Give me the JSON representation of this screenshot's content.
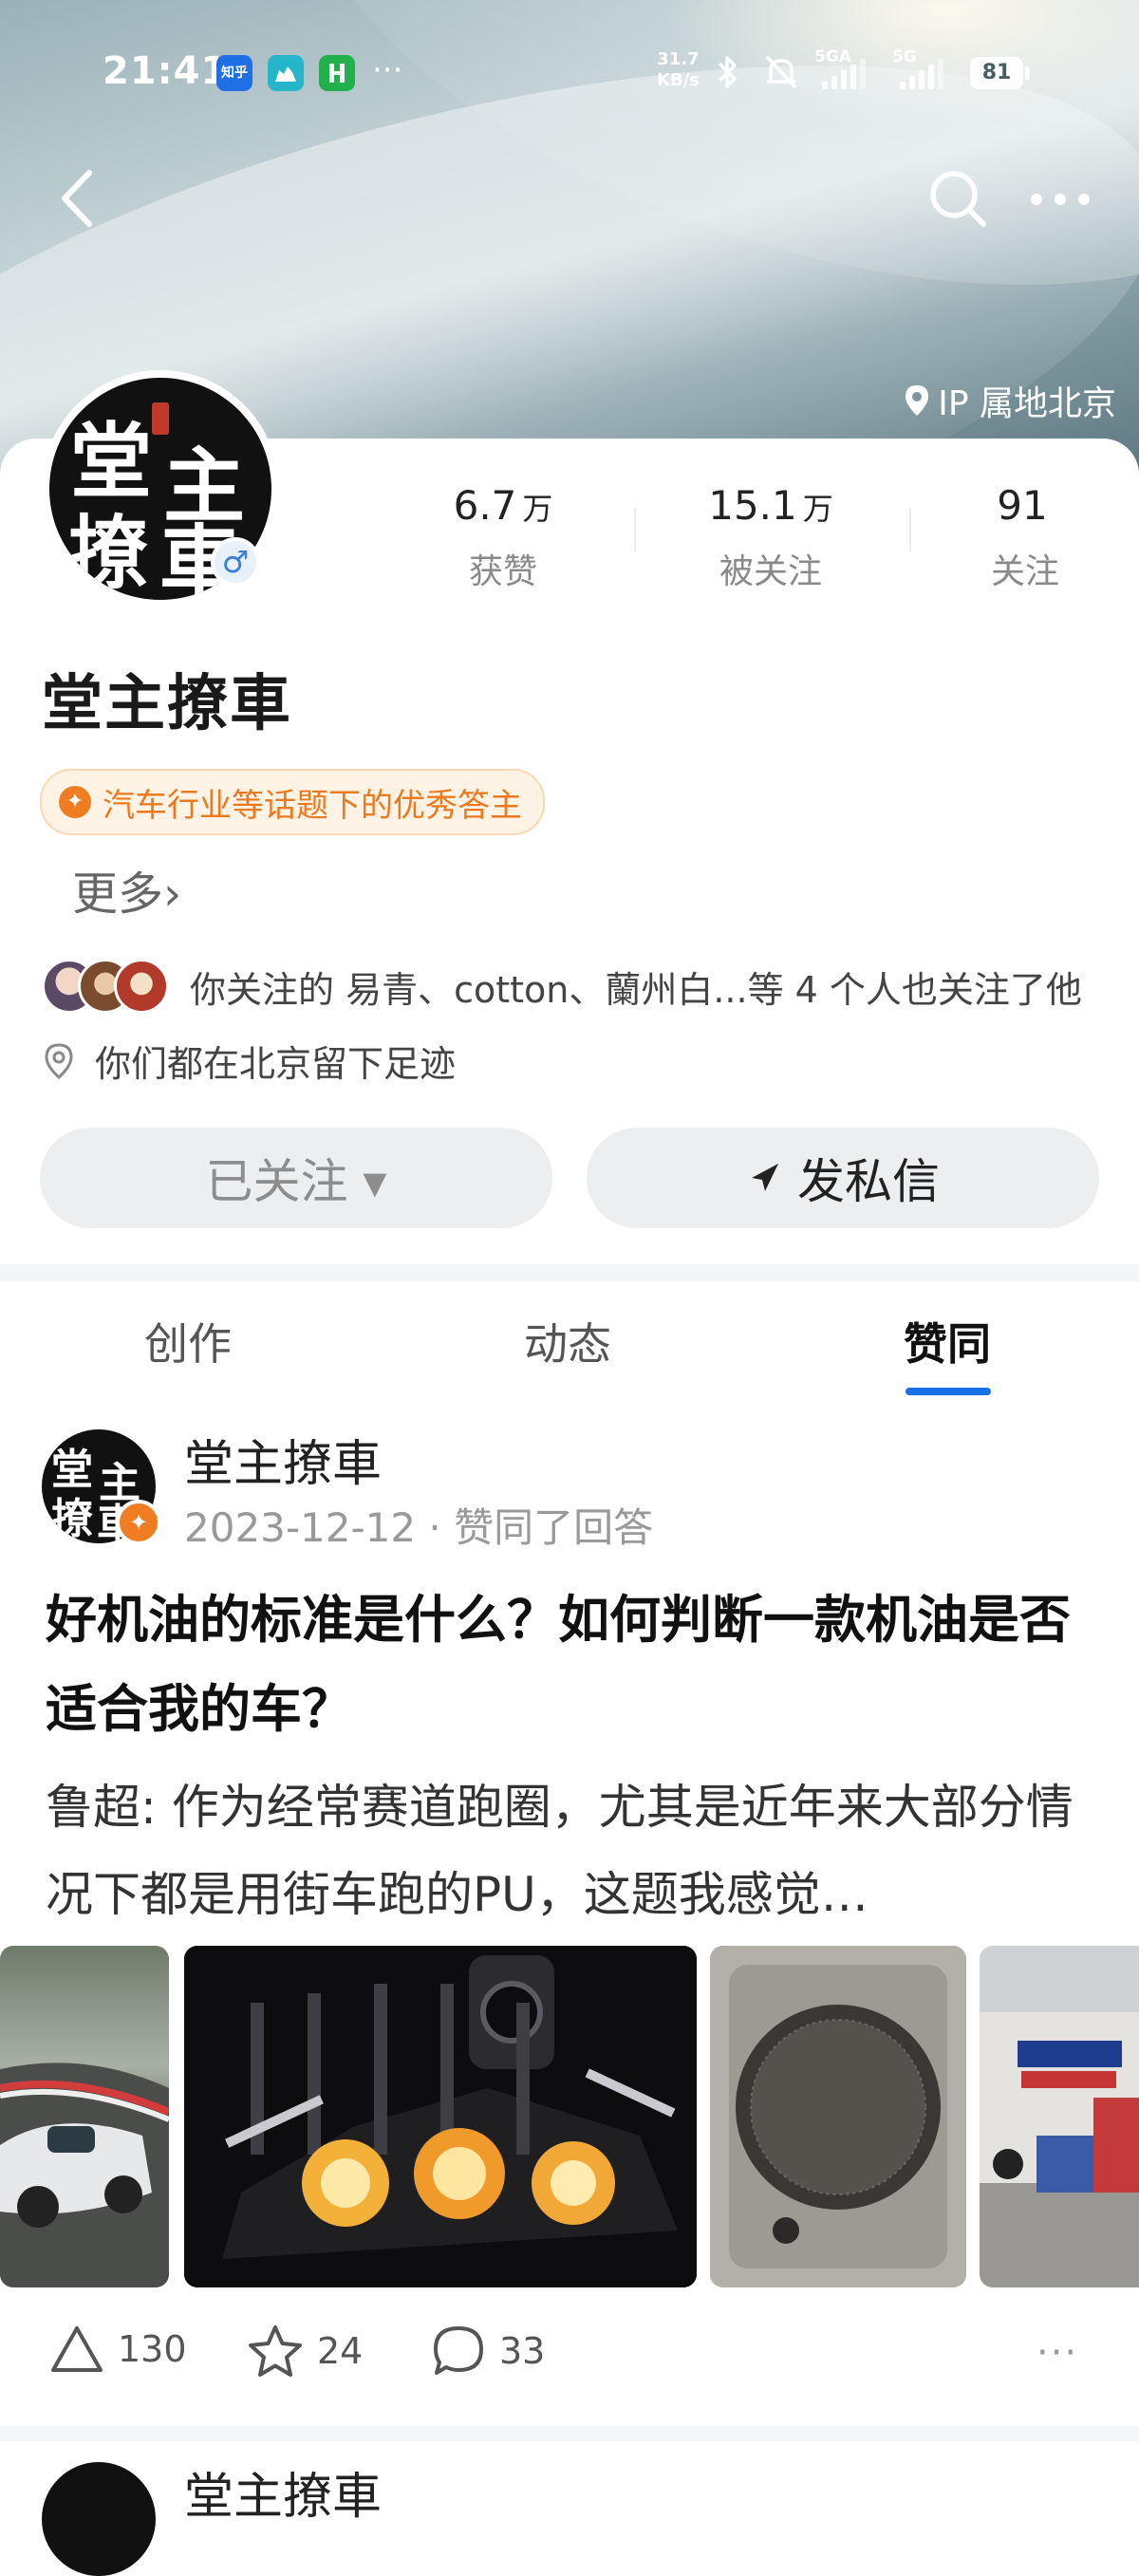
{
  "status_bar": {
    "time": "21:41",
    "apps": [
      "知乎",
      "",
      ""
    ],
    "more": "···",
    "net_speed_value": "31.7",
    "net_speed_unit": "KB/s",
    "signal_1": "5GA",
    "signal_2": "5G",
    "battery": "81"
  },
  "header": {
    "ip_location": "IP 属地北京"
  },
  "profile": {
    "avatar_text": [
      "堂",
      "主",
      "撩",
      "車"
    ],
    "gender_symbol": "♂",
    "name": "堂主撩車",
    "stats": [
      {
        "value": "6.7",
        "unit": "万",
        "label": "获赞"
      },
      {
        "value": "15.1",
        "unit": "万",
        "label": "被关注"
      },
      {
        "value": "91",
        "unit": "",
        "label": "关注"
      }
    ],
    "honor_badge": "汽车行业等话题下的优秀答主",
    "more_link": "更多›",
    "mutual_follow": "你关注的 易青、cotton、蘭州白...等 4 个人也关注了他",
    "footprint": "你们都在北京留下足迹",
    "follow_button": "已关注 ▾",
    "message_button": "发私信"
  },
  "tabs": [
    {
      "label": "创作",
      "active": false
    },
    {
      "label": "动态",
      "active": false
    },
    {
      "label": "赞同",
      "active": true
    }
  ],
  "feed": [
    {
      "author": "堂主撩車",
      "meta": "2023-12-12 · 赞同了回答",
      "title": "好机油的标准是什么？如何判断一款机油是否适合我的车？",
      "excerpt": "鲁超: 作为经常赛道跑圈，尤其是近年来大部分情况下都是用街车跑的PU，这题我感觉…",
      "likes": "130",
      "favorites": "24",
      "comments": "33"
    }
  ],
  "next_item": {
    "author": "堂主撩車"
  },
  "colors": {
    "accent_blue": "#1771e6",
    "honor_orange": "#ea7a20"
  }
}
